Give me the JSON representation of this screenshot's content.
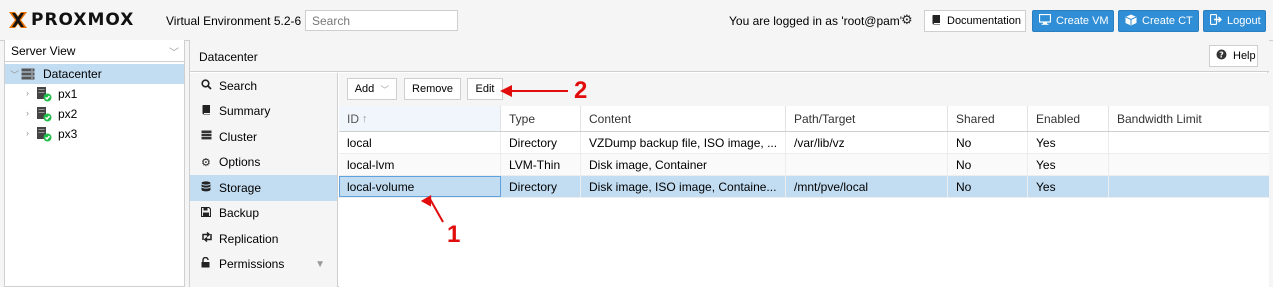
{
  "brand": {
    "logo_text": "PROXMOX",
    "version": "Virtual Environment 5.2-6"
  },
  "search": {
    "placeholder": "Search"
  },
  "header": {
    "login_text": "You are logged in as 'root@pam'",
    "documentation_label": "Documentation",
    "create_vm_label": "Create VM",
    "create_ct_label": "Create CT",
    "logout_label": "Logout"
  },
  "sidebar": {
    "view_selector": "Server View",
    "tree": [
      {
        "label": "Datacenter",
        "icon": "server-stack-icon",
        "selected": true
      },
      {
        "label": "px1",
        "icon": "node-online-icon"
      },
      {
        "label": "px2",
        "icon": "node-online-icon"
      },
      {
        "label": "px3",
        "icon": "node-online-icon"
      }
    ]
  },
  "main": {
    "title": "Datacenter",
    "help_label": "Help",
    "nav": [
      {
        "label": "Search",
        "icon": "search-icon"
      },
      {
        "label": "Summary",
        "icon": "book-icon"
      },
      {
        "label": "Cluster",
        "icon": "server-icon"
      },
      {
        "label": "Options",
        "icon": "gear-icon"
      },
      {
        "label": "Storage",
        "icon": "database-icon",
        "selected": true
      },
      {
        "label": "Backup",
        "icon": "floppy-icon"
      },
      {
        "label": "Replication",
        "icon": "retweet-icon"
      },
      {
        "label": "Permissions",
        "icon": "unlock-icon"
      }
    ],
    "toolbar": {
      "add_label": "Add",
      "remove_label": "Remove",
      "edit_label": "Edit"
    },
    "columns": [
      "ID",
      "Type",
      "Content",
      "Path/Target",
      "Shared",
      "Enabled",
      "Bandwidth Limit"
    ],
    "rows": [
      {
        "id": "local",
        "type": "Directory",
        "content": "VZDump backup file, ISO image, ...",
        "path": "/var/lib/vz",
        "shared": "No",
        "enabled": "Yes",
        "bw": ""
      },
      {
        "id": "local-lvm",
        "type": "LVM-Thin",
        "content": "Disk image, Container",
        "path": "",
        "shared": "No",
        "enabled": "Yes",
        "bw": ""
      },
      {
        "id": "local-volume",
        "type": "Directory",
        "content": "Disk image, ISO image, Containe...",
        "path": "/mnt/pve/local",
        "shared": "No",
        "enabled": "Yes",
        "bw": ""
      }
    ]
  },
  "annotations": {
    "label_1": "1",
    "label_2": "2",
    "color": "#e10c0c"
  },
  "colors": {
    "accent": "#2f8ed5",
    "selection": "#c2ddf2",
    "logo_x": "#e57000"
  }
}
